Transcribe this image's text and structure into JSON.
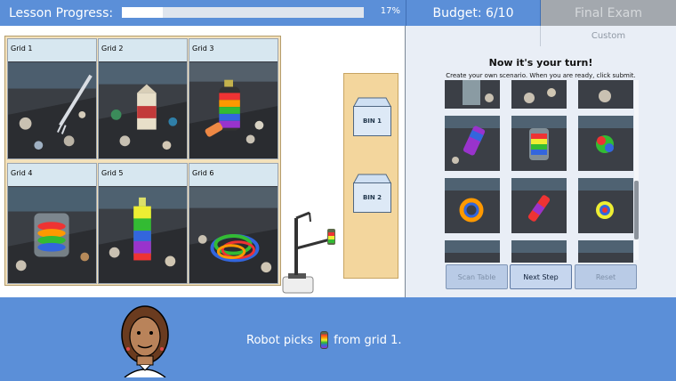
{
  "header": {
    "progress_label": "Lesson Progress:",
    "progress_percent_text": "17%",
    "progress_value": 0.17,
    "budget_text": "Budget: 6/10",
    "final_exam_label": "Final Exam",
    "custom_label": "Custom"
  },
  "grid": {
    "cells": [
      {
        "label": "Grid 1",
        "item": "fork"
      },
      {
        "label": "Grid 2",
        "item": "milk-carton"
      },
      {
        "label": "Grid 3",
        "item": "rainbow-bottle-and-cup"
      },
      {
        "label": "Grid 4",
        "item": "rainbow-jar"
      },
      {
        "label": "Grid 5",
        "item": "rainbow-bottle"
      },
      {
        "label": "Grid 6",
        "item": "rainbow-yarn"
      }
    ]
  },
  "bins": {
    "bin1_label": "BIN 1",
    "bin2_label": "BIN 2"
  },
  "scenario": {
    "title": "Now it's your turn!",
    "subtitle": "Create your own scenario. When you are ready, click submit.",
    "thumb_items": [
      "jar",
      "paper",
      "paper",
      "rainbow-can",
      "rainbow-jar",
      "rainbow-ball",
      "rainbow-ring",
      "rainbow-marker",
      "rainbow-lid",
      "debris",
      "debris",
      "debris"
    ]
  },
  "buttons": {
    "scan_table": "Scan Table",
    "next_step": "Next Step",
    "reset": "Reset"
  },
  "status": {
    "message_prefix": "Robot picks",
    "message_suffix": "from grid 1."
  },
  "colors": {
    "accent_blue": "#5b8fd8",
    "panel_tan": "#f3e1bb",
    "bin_panel": "#f3d69d",
    "disabled_gray": "#a3a8ae"
  }
}
